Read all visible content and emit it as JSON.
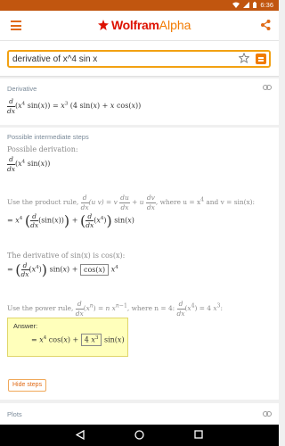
{
  "status_bar": {
    "time": "6:36"
  },
  "app_bar": {
    "logo_wolfram": "Wolfram",
    "logo_alpha": "Alpha"
  },
  "search": {
    "query": "derivative of x^4 sin x"
  },
  "pods": {
    "derivative": {
      "title": "Derivative"
    },
    "steps": {
      "title": "Possible intermediate steps",
      "possible_derivation": "Possible derivation:"
    },
    "plots": {
      "title": "Plots"
    }
  },
  "steps_text": {
    "product_rule_prefix": "Use the product rule,",
    "where_u_is": ", where u = x",
    "and_v_is": "and v = sin(x):",
    "derivative_of_sin": "The derivative of sin(x) is cos(x):",
    "power_rule_prefix": "Use the power rule,",
    "where_n_is": ", where n = 4:"
  },
  "answer": {
    "label": "Answer:"
  },
  "hide_steps_button": "Hide steps",
  "icons": [
    "menu-icon",
    "share-icon",
    "star-icon",
    "equals-icon",
    "link-icon",
    "back-icon",
    "home-icon",
    "recents-icon",
    "wifi-icon",
    "signal-icon",
    "battery-icon"
  ]
}
